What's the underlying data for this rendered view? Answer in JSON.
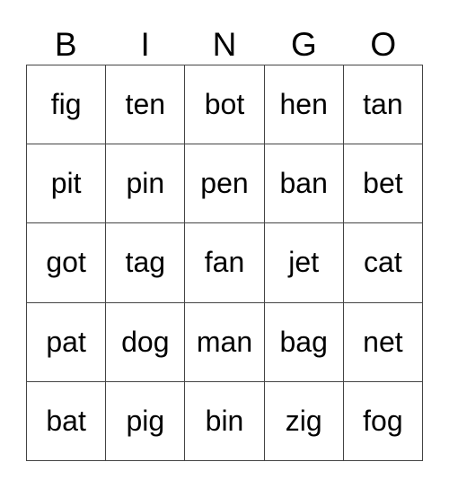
{
  "header": [
    "B",
    "I",
    "N",
    "G",
    "O"
  ],
  "rows": [
    [
      "fig",
      "ten",
      "bot",
      "hen",
      "tan"
    ],
    [
      "pit",
      "pin",
      "pen",
      "ban",
      "bet"
    ],
    [
      "got",
      "tag",
      "fan",
      "jet",
      "cat"
    ],
    [
      "pat",
      "dog",
      "man",
      "bag",
      "net"
    ],
    [
      "bat",
      "pig",
      "bin",
      "zig",
      "fog"
    ]
  ]
}
